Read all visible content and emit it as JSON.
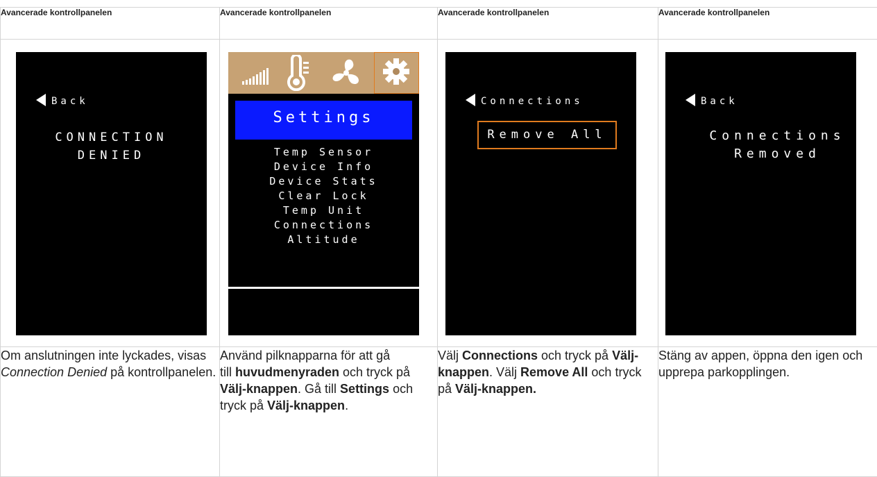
{
  "columns": [
    {
      "header": "Avancerade kontrollpanelen",
      "screen": {
        "back_label": "Back",
        "message_line1": "CONNECTION",
        "message_line2": "DENIED"
      },
      "caption": {
        "t1": "Om anslutningen inte lyckades, visas ",
        "em1": "Connection Denied",
        "t2": " på kontrollpanelen."
      }
    },
    {
      "header": "Avancerade kontrollpanelen",
      "screen": {
        "icons": [
          "signal-bars-icon",
          "thermometer-icon",
          "fan-icon",
          "gear-icon"
        ],
        "title": "Settings",
        "menu_items": [
          "Temp Sensor",
          "Device Info",
          "Device Stats",
          "Clear Lock",
          "Temp Unit",
          "Connections",
          "Altitude"
        ],
        "accent_color": "#0a1aff",
        "menubar_color": "#c7a274",
        "highlight_color": "#e07b1e"
      },
      "caption": {
        "t1": "Använd pilknapparna för att gå",
        "t2": "till ",
        "b1": "huvudmenyraden",
        "t3": " och tryck på ",
        "b2": "Välj-knappen",
        "t4": ". Gå till ",
        "b3": "Settings",
        "t5": " och tryck på ",
        "b4": "Välj-knappen",
        "t6": "."
      }
    },
    {
      "header": "Avancerade kontrollpanelen",
      "screen": {
        "back_label": "Connections",
        "button_label": "Remove All"
      },
      "caption": {
        "t1": "Välj ",
        "b1": "Connections",
        "t2": " och tryck på ",
        "b2": "Välj-knappen",
        "t3": ". Välj ",
        "b3": "Remove All",
        "t4": " och tryck på ",
        "b4": "Välj-knappen."
      }
    },
    {
      "header": "Avancerade kontrollpanelen",
      "screen": {
        "back_label": "Back",
        "message_line1": "Connections",
        "message_line2": "Removed"
      },
      "caption": {
        "t1": "Stäng av appen, öppna den igen och upprepa parkopplingen."
      }
    }
  ]
}
